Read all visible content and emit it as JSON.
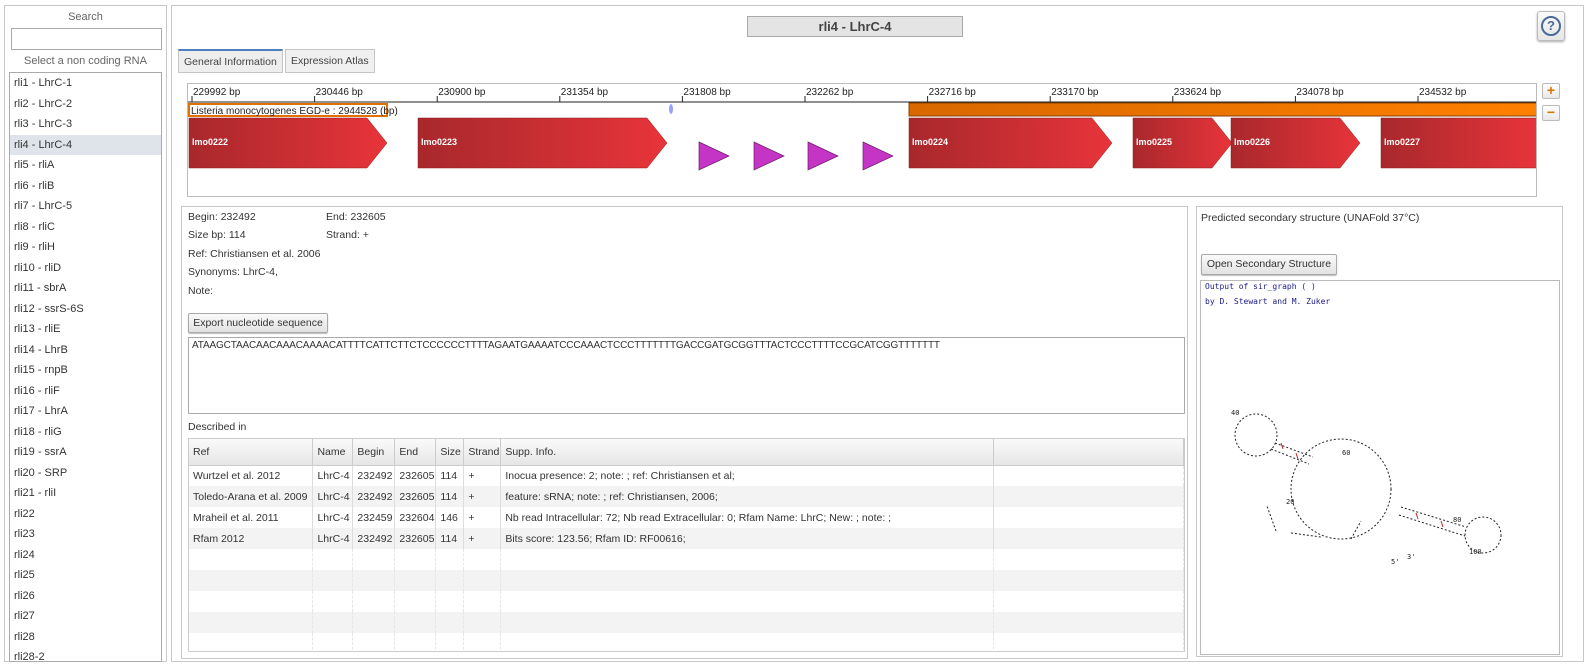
{
  "sidebar": {
    "search_label": "Search",
    "search_value": "",
    "select_label": "Select a non coding RNA",
    "items": [
      "rli1 - LhrC-1",
      "rli2 - LhrC-2",
      "rli3 - LhrC-3",
      "rli4 - LhrC-4",
      "rli5 - rliA",
      "rli6 - rliB",
      "rli7 - LhrC-5",
      "rli8 - rliC",
      "rli9 - rliH",
      "rli10 - rliD",
      "rli11 - sbrA",
      "rli12 - ssrS-6S",
      "rli13 - rliE",
      "rli14 - LhrB",
      "rli15 - rnpB",
      "rli16 - rliF",
      "rli17 - LhrA",
      "rli18 - rliG",
      "rli19 - ssrA",
      "rli20 - SRP",
      "rli21 - rliI",
      "rli22",
      "rli23",
      "rli24",
      "rli25",
      "rli26",
      "rli27",
      "rli28",
      "rli28-2"
    ],
    "selected_index": 3
  },
  "header": {
    "title": "rli4 - LhrC-4",
    "help_icon": "question-circle-icon"
  },
  "tabs": [
    {
      "label": "General Information",
      "active": true
    },
    {
      "label": "Expression Atlas",
      "active": false
    }
  ],
  "browser": {
    "ticks": [
      "229992 bp",
      "230446 bp",
      "230900 bp",
      "231354 bp",
      "231808 bp",
      "232262 bp",
      "232716 bp",
      "233170 bp",
      "233624 bp",
      "234078 bp",
      "234532 bp"
    ],
    "genome_label": "Listeria monocytogenes EGD-e : 2944528 (bp)",
    "genes": [
      "lmo0222",
      "lmo0223",
      "lmo0224",
      "lmo0225",
      "lmo0226",
      "lmo0227"
    ],
    "zoom_in": "+",
    "zoom_out": "−",
    "colors": {
      "gene": "#d63035",
      "genome": "#f07800",
      "srna": "#c535c5"
    }
  },
  "info": {
    "begin": "Begin: 232492",
    "end": "End: 232605",
    "size": "Size bp: 114",
    "strand": "Strand: +",
    "ref": "Ref: Christiansen et al. 2006",
    "synonyms": "Synonyms: LhrC-4,",
    "note": "Note:",
    "export_label": "Export nucleotide sequence",
    "sequence": "ATAAGCTAACAACAAACAAAACATTTTCATTCTTCTCCCCCCTTTTAGAATGAAAATCCCAAACTCCCTTTTTTTGACCGATGCGGTTTACTCCCTTTTCCGCATCGGTTTTTTT",
    "described_in": "Described in",
    "columns": [
      "Ref",
      "Name",
      "Begin",
      "End",
      "Size",
      "Strand",
      "Supp. Info.",
      ""
    ],
    "rows": [
      [
        "Wurtzel et al. 2012",
        "LhrC-4",
        "232492",
        "232605",
        "114",
        "+",
        "Inocua presence: 2; note: ; ref: Christiansen et al;"
      ],
      [
        "Toledo-Arana et al. 2009",
        "LhrC-4",
        "232492",
        "232605",
        "114",
        "+",
        "feature: sRNA; note: ; ref: Christiansen, 2006;"
      ],
      [
        "Mraheil et al. 2011",
        "LhrC-4",
        "232459",
        "232604",
        "146",
        "+",
        "Nb read Intracellular: 72; Nb read Extracellular: 0; Rfam Name: LhrC; New: ; note: ;"
      ],
      [
        "Rfam 2012",
        "LhrC-4",
        "232492",
        "232605",
        "114",
        "+",
        "Bits score: 123.56; Rfam ID: RF00616;"
      ]
    ]
  },
  "structure": {
    "title": "Predicted secondary structure (UNAFold 37°C)",
    "open_label": "Open Secondary Structure",
    "output_line1": "Output of sir_graph ( )",
    "output_line2": "by D. Stewart and M. Zuker",
    "labels": {
      "n20": "20",
      "n40": "40",
      "n60": "60",
      "n80": "80",
      "n100": "100",
      "five": "5'",
      "three": "3'"
    }
  }
}
